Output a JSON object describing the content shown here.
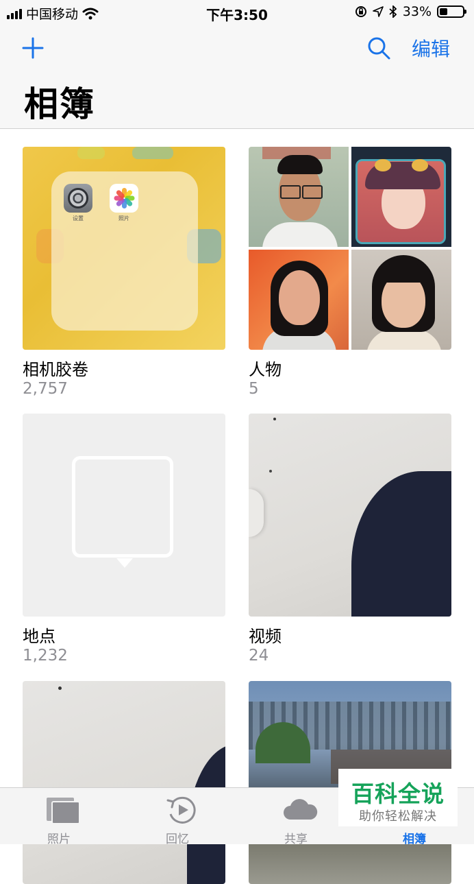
{
  "status_bar": {
    "carrier": "中国移动",
    "time": "下午3:50",
    "battery": "33%",
    "battery_level": 0.33,
    "icons": [
      "signal-icon",
      "wifi-icon",
      "orientation-lock-icon",
      "location-icon",
      "bluetooth-icon",
      "battery-icon"
    ]
  },
  "header": {
    "title": "相簿",
    "edit_label": "编辑",
    "accent_color": "#1a73e8"
  },
  "albums": [
    {
      "name": "相机胶卷",
      "count": "2,757",
      "apps": [
        {
          "label": "设置"
        },
        {
          "label": "照片"
        }
      ]
    },
    {
      "name": "人物",
      "count": "5"
    },
    {
      "name": "地点",
      "count": "1,232"
    },
    {
      "name": "视频",
      "count": "24"
    }
  ],
  "tabbar": {
    "tabs": [
      {
        "label": "照片",
        "icon": "photos-stack-icon",
        "active": false
      },
      {
        "label": "回忆",
        "icon": "memories-icon",
        "active": false
      },
      {
        "label": "共享",
        "icon": "cloud-icon",
        "active": false
      },
      {
        "label": "相簿",
        "icon": "albums-icon",
        "active": true
      }
    ]
  },
  "watermark": {
    "title": "百科全说",
    "subtitle": "助你轻松解决"
  }
}
